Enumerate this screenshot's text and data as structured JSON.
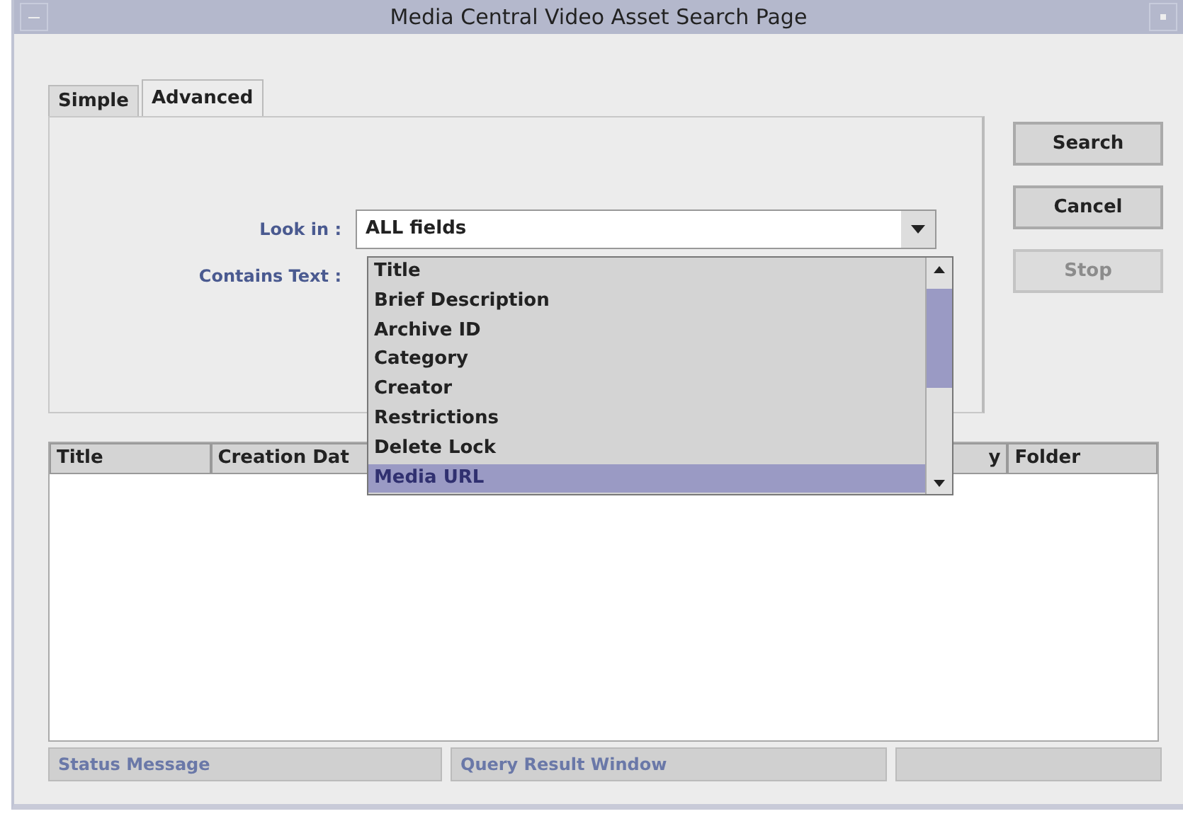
{
  "window": {
    "title": "Media Central Video Asset Search Page"
  },
  "tabs": [
    {
      "label": "Simple",
      "selected": false
    },
    {
      "label": "Advanced",
      "selected": true
    }
  ],
  "form": {
    "look_in_label": "Look in :",
    "look_in_value": "ALL fields",
    "contains_label": "Contains Text :"
  },
  "dropdown": {
    "items": [
      {
        "label": "Title",
        "selected": false
      },
      {
        "label": "Brief Description",
        "selected": false
      },
      {
        "label": "Archive ID",
        "selected": false
      },
      {
        "label": "Category",
        "selected": false
      },
      {
        "label": "Creator",
        "selected": false
      },
      {
        "label": "Restrictions",
        "selected": false
      },
      {
        "label": "Delete Lock",
        "selected": false
      },
      {
        "label": "Media URL",
        "selected": true
      }
    ]
  },
  "buttons": [
    {
      "label": "Search",
      "disabled": false
    },
    {
      "label": "Cancel",
      "disabled": false
    },
    {
      "label": "Stop",
      "disabled": true
    }
  ],
  "table": {
    "columns": [
      "Title",
      "Creation Dat",
      "y",
      "Folder"
    ]
  },
  "status_bar": {
    "message": "Status Message",
    "query": "Query Result Window"
  }
}
